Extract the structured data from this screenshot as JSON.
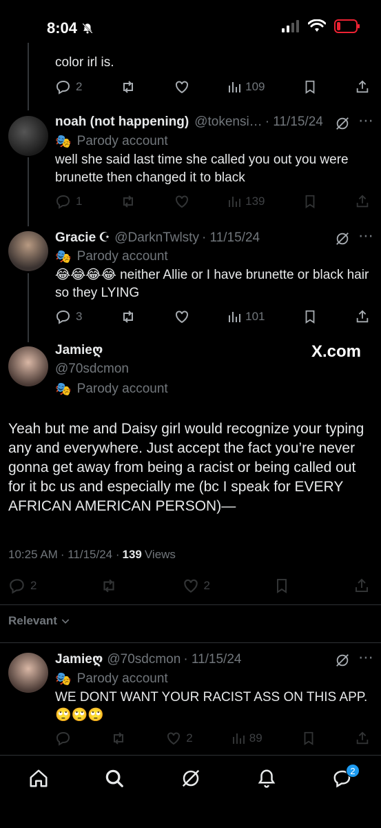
{
  "status": {
    "time": "8:04",
    "bell_muted": true
  },
  "top_tweet": {
    "text_tail": "color irl is.",
    "replies": "2",
    "views": "109"
  },
  "replies_above": [
    {
      "name": "noah (not happening)",
      "handle": "@tokensi…",
      "date": "· 11/15/24",
      "label": "Parody account",
      "text": "well she said last time she called you out you were brunette then changed it to black",
      "replies": "1",
      "views": "139"
    },
    {
      "name": "Gracie",
      "badge": "☪",
      "handle": "@DarknTwlsty",
      "date": "· 11/15/24",
      "label": "Parody account",
      "text": "😂😂😂😂 neither Allie or I have brunette or black hair so they LYING",
      "replies": "3",
      "views": "101"
    }
  ],
  "main_tweet": {
    "name": "Jamie",
    "name_suffix": "ღ",
    "handle": "@70sdcmon",
    "label": "Parody account",
    "watermark": "X.com",
    "text": "Yeah but me and Daisy girl would recognize your typing any and everywhere. Just accept the fact you’re never gonna get away from being a racist or being called out for it bc us and especially me (bc I speak for EVERY AFRICAN AMERICAN PERSON)—",
    "time": "10:25 AM",
    "date": "· 11/15/24 ·",
    "views_count": "139",
    "views_label": "Views",
    "replies": "2",
    "likes": "2"
  },
  "sort": {
    "label": "Relevant"
  },
  "reply_below": {
    "name": "Jamie",
    "name_suffix": "ღ",
    "handle": "@70sdcmon",
    "date": "· 11/15/24",
    "label": "Parody account",
    "text": "WE DONT WANT YOUR RACIST ASS ON THIS APP. 🙄🙄🙄",
    "likes": "2",
    "views": "89"
  },
  "tab_bar": {
    "messages_badge": "2"
  }
}
